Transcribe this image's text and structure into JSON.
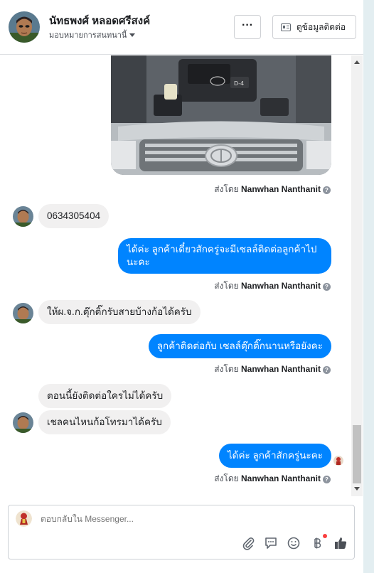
{
  "header": {
    "name": "นัทธพงศ์ หลอดศรีสงค์",
    "assign_label": "มอบหมายการสนทนานี้",
    "more_label": "···",
    "contact_label": "ดูข้อมูลติดต่อ"
  },
  "messages": [
    {
      "id": "m1",
      "direction": "outgoing",
      "type": "image",
      "image_desc": "engine-photo"
    },
    {
      "id": "meta1",
      "sent_by_prefix": "ส่งโดย",
      "sent_by_name": "Nanwhan Nanthanit"
    },
    {
      "id": "m2",
      "direction": "incoming",
      "text": "0634305404"
    },
    {
      "id": "m3",
      "direction": "outgoing",
      "text": "ได้ค่ะ ลูกค้าเดี๋ยวสักครู่จะมีเซลล์ติดต่อลูกค้าไปนะคะ"
    },
    {
      "id": "meta2",
      "sent_by_prefix": "ส่งโดย",
      "sent_by_name": "Nanwhan Nanthanit"
    },
    {
      "id": "m4",
      "direction": "incoming",
      "text": "ให้ผ.จ.ก.ตุ๊กติ๊กรับสายบ้างก้อได้ครับ"
    },
    {
      "id": "m5",
      "direction": "outgoing",
      "text": "ลูกค้าติดต่อกับ เซลล์ตุ๊กติ๊กนานหรือยังคะ"
    },
    {
      "id": "meta3",
      "sent_by_prefix": "ส่งโดย",
      "sent_by_name": "Nanwhan Nanthanit"
    },
    {
      "id": "m6",
      "direction": "incoming",
      "text": "ตอนนี้ยังติดต่อใครไม่ได้ครับ"
    },
    {
      "id": "m7",
      "direction": "incoming",
      "text": "เชลคนไหนก้อโทรมาได้ครับ"
    },
    {
      "id": "m8",
      "direction": "outgoing",
      "text": "ได้ค่ะ ลูกค้าสักครู่นะคะ"
    },
    {
      "id": "meta4",
      "sent_by_prefix": "ส่งโดย",
      "sent_by_name": "Nanwhan Nanthanit"
    }
  ],
  "composer": {
    "placeholder": "ตอบกลับใน Messenger..."
  },
  "icons": {
    "attach": "paperclip-icon",
    "saved_replies": "chat-bubble-icon",
    "emoji": "smiley-icon",
    "payment": "baht-icon",
    "like": "thumbs-up-icon"
  },
  "colors": {
    "outgoing_bubble": "#0084ff",
    "incoming_bubble": "#f1f0f0",
    "notification_dot": "#fa3e3e"
  }
}
